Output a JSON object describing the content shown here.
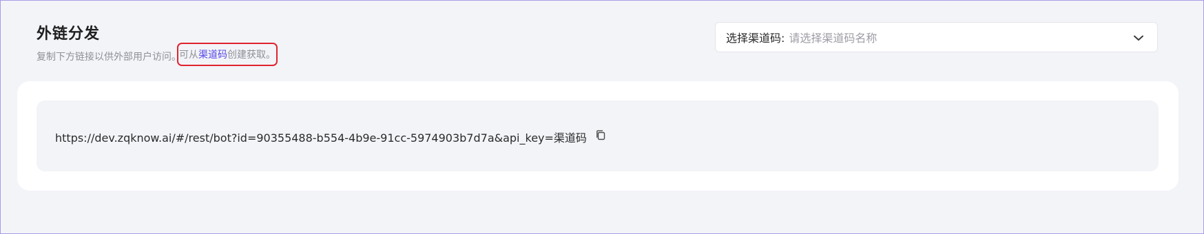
{
  "header": {
    "title": "外链分发",
    "subtitle": "复制下方链接以供外部用户访问。",
    "hint_prefix": "可从",
    "hint_link": "渠道码",
    "hint_suffix": "创建获取。"
  },
  "channel_select": {
    "label": "选择渠道码:",
    "placeholder": "请选择渠道码名称",
    "icon": "chevron-down-icon"
  },
  "link_panel": {
    "url": "https://dev.zqknow.ai/#/rest/bot?id=90355488-b554-4b9e-91cc-5974903b7d7a&api_key=渠道码",
    "copy_icon": "copy-icon"
  },
  "colors": {
    "accent": "#5548e6",
    "highlight_border": "#e0232e",
    "page_background": "#f3f4f8",
    "card_background": "#ffffff"
  }
}
